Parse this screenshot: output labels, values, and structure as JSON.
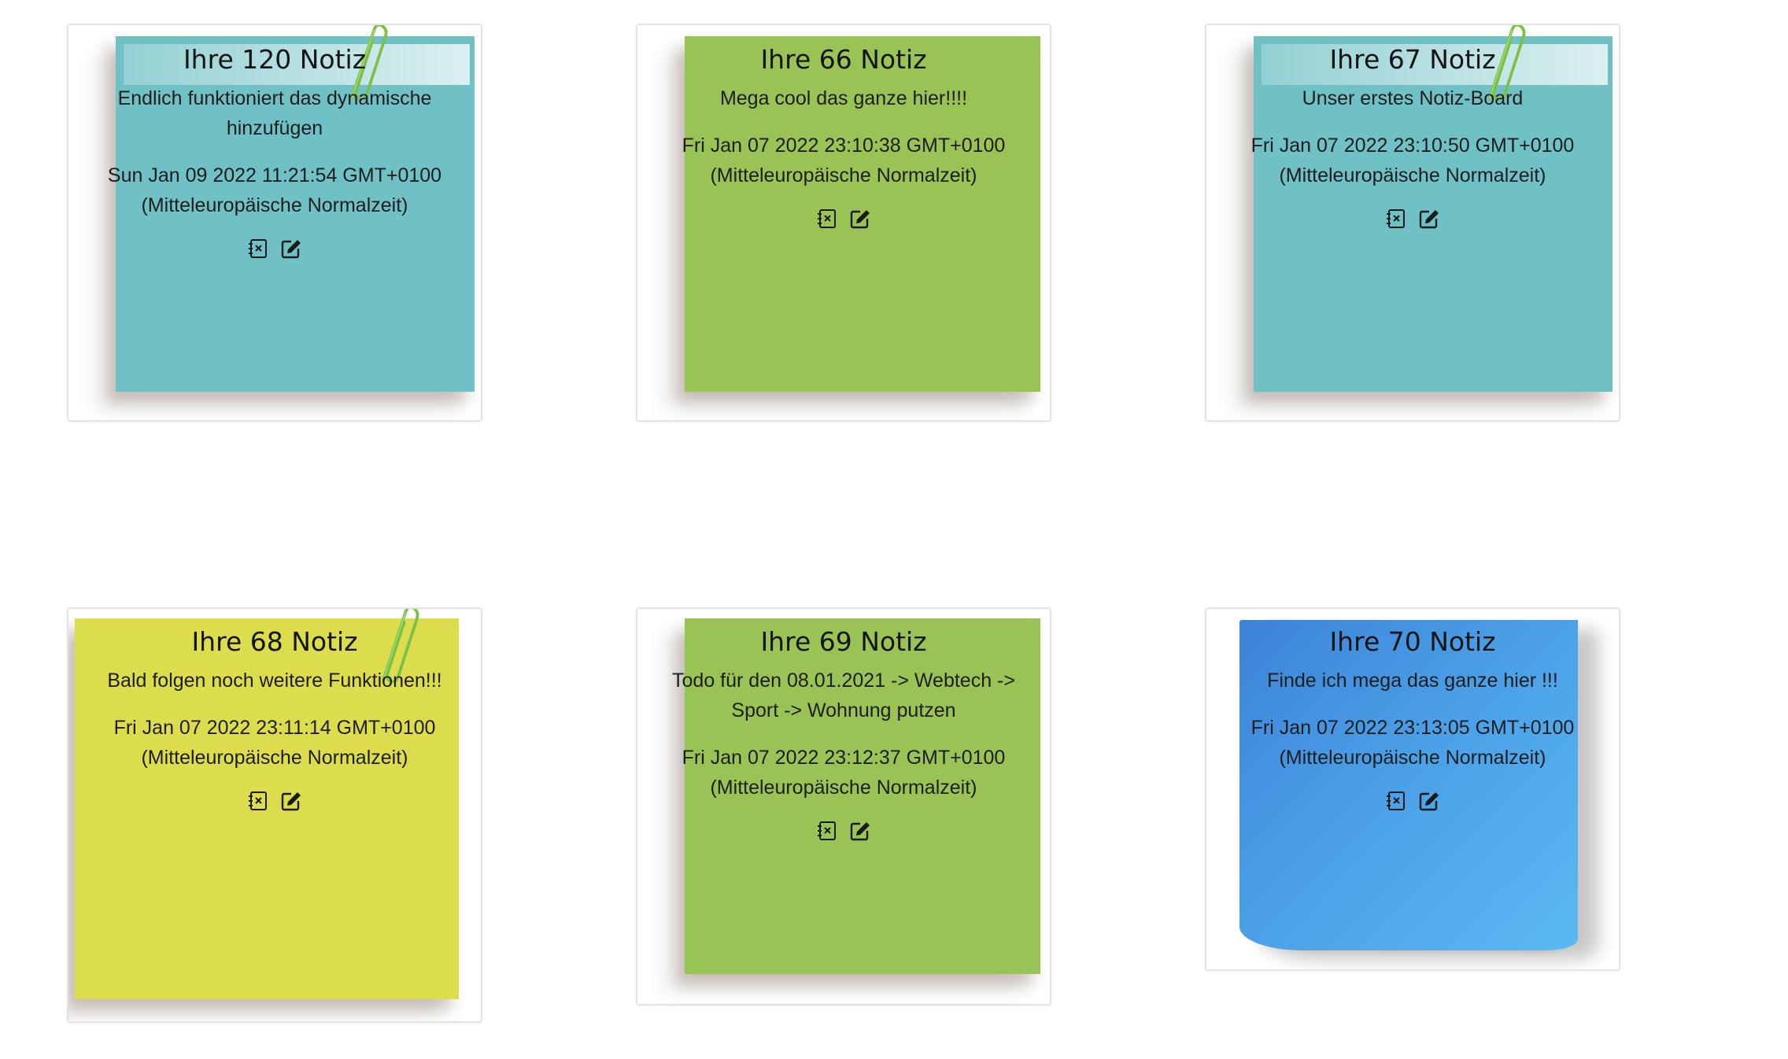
{
  "notes": [
    {
      "title": "Ihre 120 Notiz",
      "text": "Endlich funktioniert das dynamische hinzufügen",
      "date": "Sun Jan 09 2022 11:21:54 GMT+0100",
      "tz": "(Mitteleuropäische Normalzeit)",
      "color": "#6fc1c5"
    },
    {
      "title": "Ihre 66 Notiz",
      "text": "Mega cool das ganze hier!!!!",
      "date": "Fri Jan 07 2022 23:10:38 GMT+0100",
      "tz": "(Mitteleuropäische Normalzeit)",
      "color": "#9ac355"
    },
    {
      "title": "Ihre 67 Notiz",
      "text": "Unser erstes Notiz-Board",
      "date": "Fri Jan 07 2022 23:10:50 GMT+0100",
      "tz": "(Mitteleuropäische Normalzeit)",
      "color": "#6fc1c5"
    },
    {
      "title": "Ihre 68 Notiz",
      "text": "Bald folgen noch weitere Funktionen!!!",
      "date": "Fri Jan 07 2022 23:11:14 GMT+0100",
      "tz": "(Mitteleuropäische Normalzeit)",
      "color": "#dbdd4c"
    },
    {
      "title": "Ihre 69 Notiz",
      "text": "Todo für den 08.01.2021 -> Webtech -> Sport -> Wohnung putzen",
      "date": "Fri Jan 07 2022 23:12:37 GMT+0100",
      "tz": "(Mitteleuropäische Normalzeit)",
      "color": "#9ac355"
    },
    {
      "title": "Ihre 70 Notiz",
      "text": "Finde ich mega das ganze hier !!!",
      "date": "Fri Jan 07 2022 23:13:05 GMT+0100",
      "tz": "(Mitteleuropäische Normalzeit)",
      "color": "#4a9fe6"
    }
  ],
  "icons": {
    "delete": "delete-note-icon",
    "edit": "edit-note-icon"
  }
}
